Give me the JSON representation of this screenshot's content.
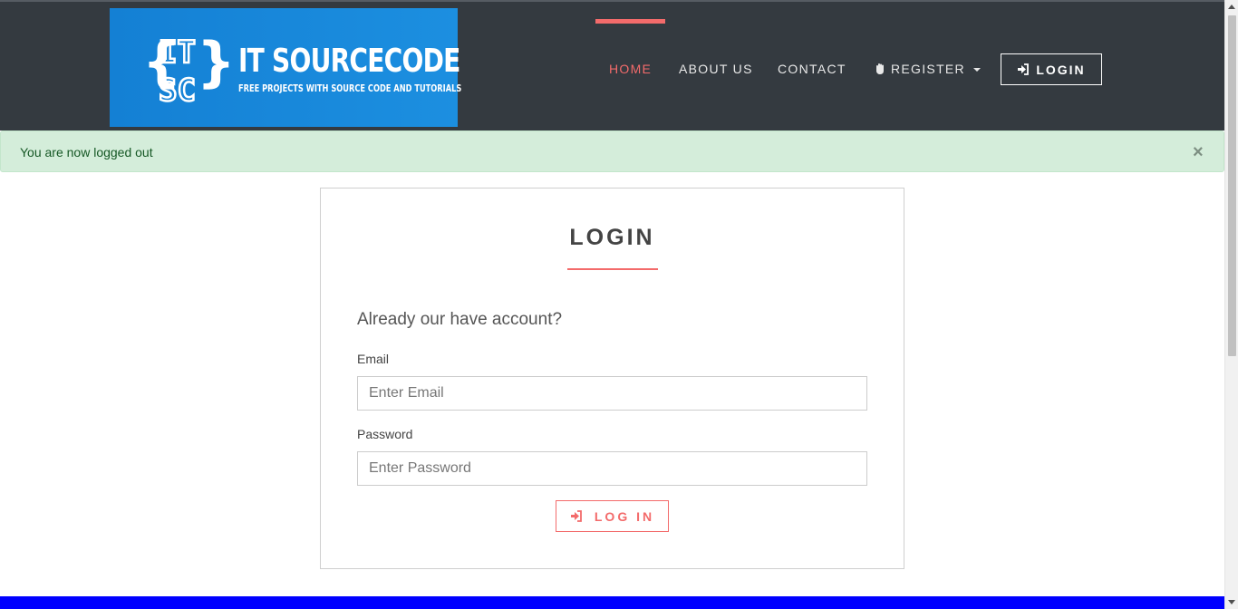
{
  "brand": {
    "logo_letters": "IT SC",
    "title": "IT SOURCECODE",
    "subtitle": "FREE PROJECTS WITH SOURCE CODE AND TUTORIALS"
  },
  "nav": {
    "home": "HOME",
    "about": "ABOUT US",
    "contact": "CONTACT",
    "register": "REGISTER",
    "login": "LOGIN",
    "active_color": "#f36b6b"
  },
  "alert": {
    "message": "You are now logged out",
    "close_symbol": "×"
  },
  "login_form": {
    "title": "LOGIN",
    "subheading": "Already our have account?",
    "email_label": "Email",
    "email_placeholder": "Enter Email",
    "password_label": "Password",
    "password_placeholder": "Enter Password",
    "submit_label": "LOG IN"
  },
  "colors": {
    "navbar": "#343a40",
    "accent": "#f36b6b",
    "alert_bg": "#d4edda",
    "brand_blue": "#1c8fe0",
    "footer": "#0000ff"
  }
}
